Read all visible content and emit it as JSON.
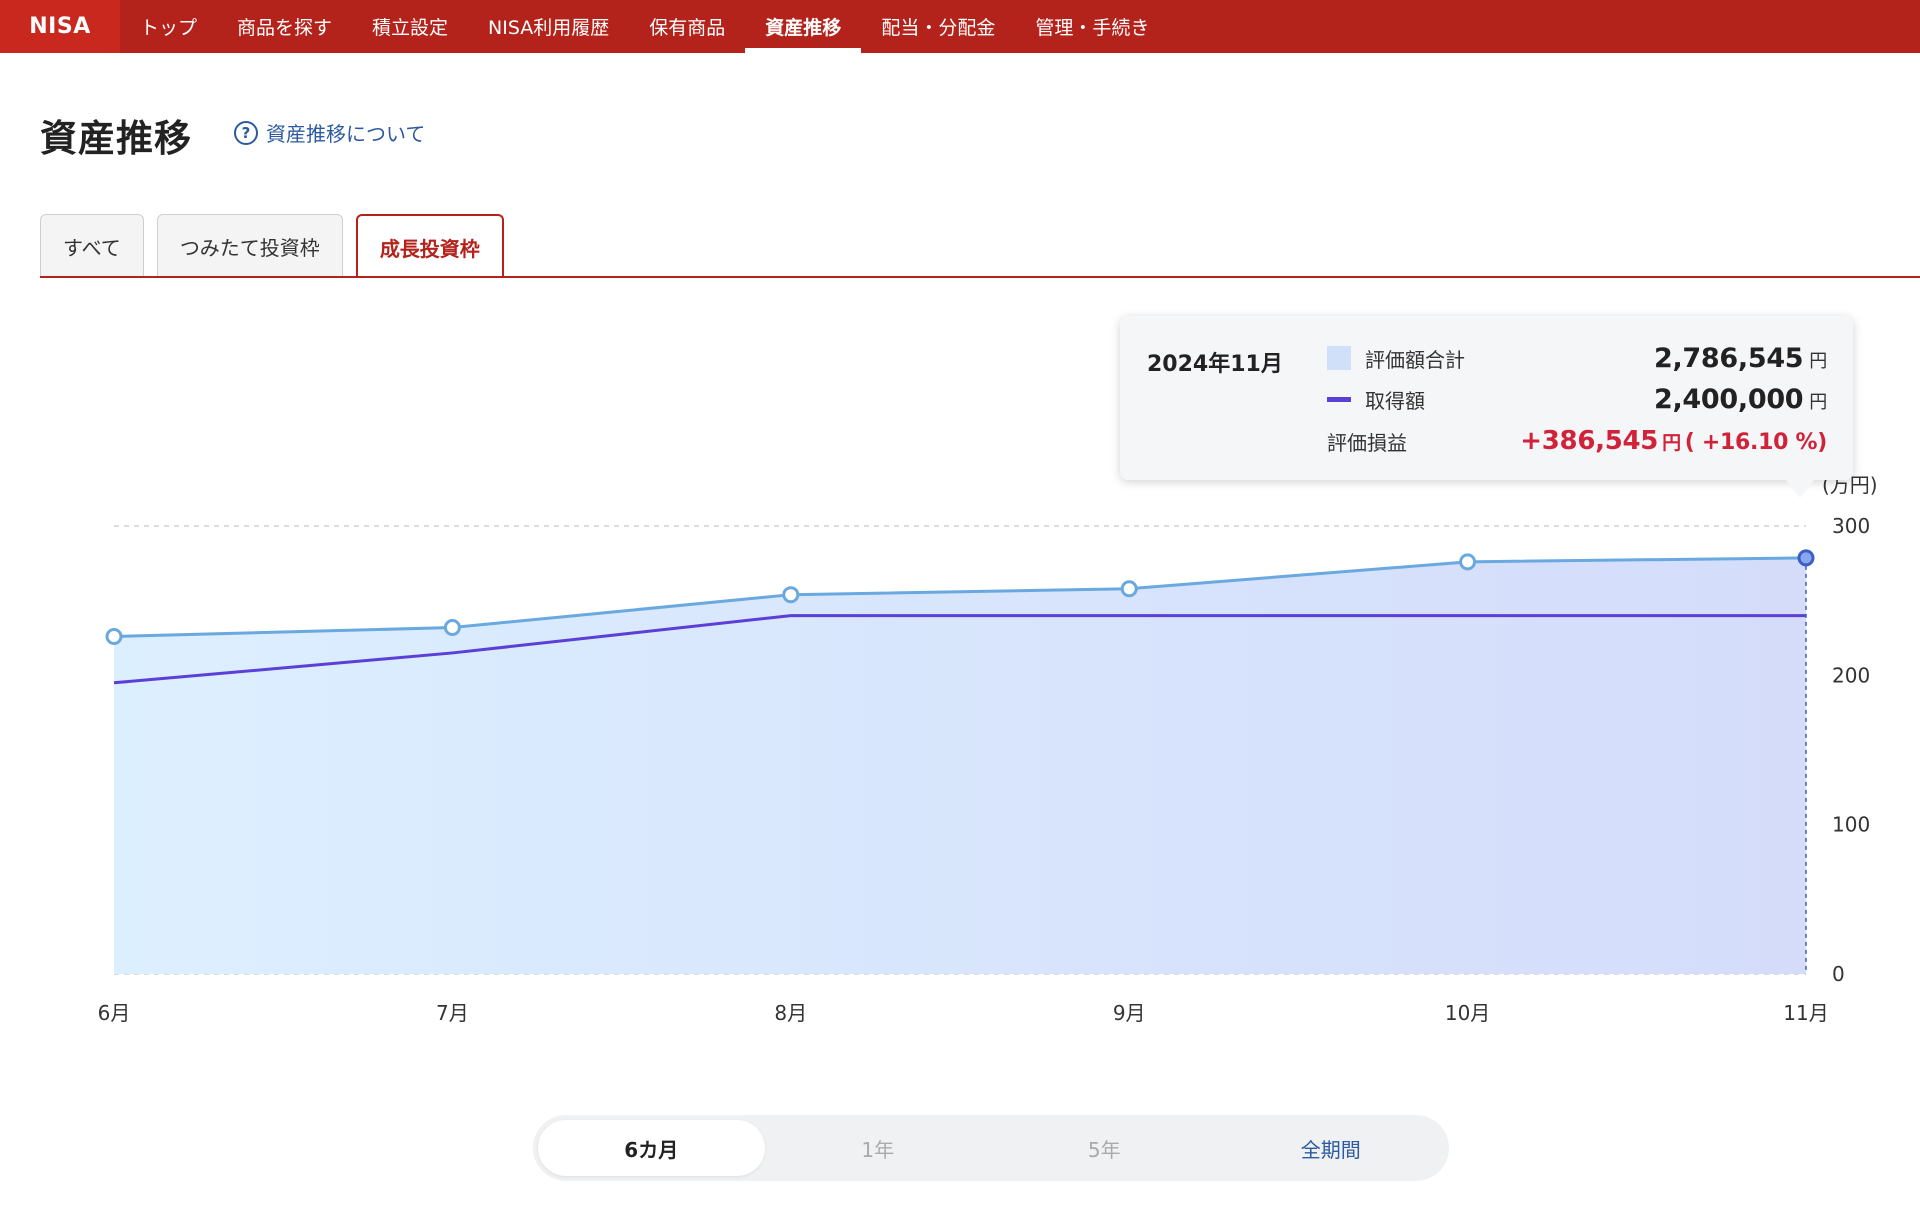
{
  "nav": {
    "logo": "NISA",
    "items": [
      {
        "label": "トップ",
        "active": false
      },
      {
        "label": "商品を探す",
        "active": false
      },
      {
        "label": "積立設定",
        "active": false
      },
      {
        "label": "NISA利用履歴",
        "active": false
      },
      {
        "label": "保有商品",
        "active": false
      },
      {
        "label": "資産推移",
        "active": true
      },
      {
        "label": "配当・分配金",
        "active": false
      },
      {
        "label": "管理・手続き",
        "active": false
      }
    ]
  },
  "page": {
    "title": "資産推移",
    "help_link": "資産推移について",
    "help_icon": "question-circle-icon"
  },
  "tabs": [
    {
      "label": "すべて",
      "active": false
    },
    {
      "label": "つみたて投資枠",
      "active": false
    },
    {
      "label": "成長投資枠",
      "active": true
    }
  ],
  "tooltip": {
    "date": "2024年11月",
    "rows": {
      "valuation_label": "評価額合計",
      "valuation_value": "2,786,545",
      "acquisition_label": "取得額",
      "acquisition_value": "2,400,000",
      "gain_label": "評価損益",
      "gain_value": "+386,545",
      "gain_pct": "( +16.10 %)",
      "unit": "円"
    }
  },
  "chart_data": {
    "type": "area",
    "unit_label": "(万円)",
    "categories": [
      "6月",
      "7月",
      "8月",
      "9月",
      "10月",
      "11月"
    ],
    "series": [
      {
        "name": "評価額合計",
        "values": [
          226,
          232,
          254,
          258,
          276,
          278.6545
        ],
        "style": "area",
        "color": "#6aa8e0"
      },
      {
        "name": "取得額",
        "values": [
          195,
          215,
          240,
          240,
          240,
          240
        ],
        "style": "line",
        "color": "#5b3fd6"
      }
    ],
    "ylim": [
      0,
      300
    ],
    "yticks": [
      0,
      100,
      200,
      300
    ],
    "grid": true,
    "highlight_index": 5
  },
  "period": {
    "options": [
      {
        "label": "6カ月",
        "state": "active"
      },
      {
        "label": "1年",
        "state": "disabled"
      },
      {
        "label": "5年",
        "state": "disabled"
      },
      {
        "label": "全期間",
        "state": "link"
      }
    ]
  }
}
